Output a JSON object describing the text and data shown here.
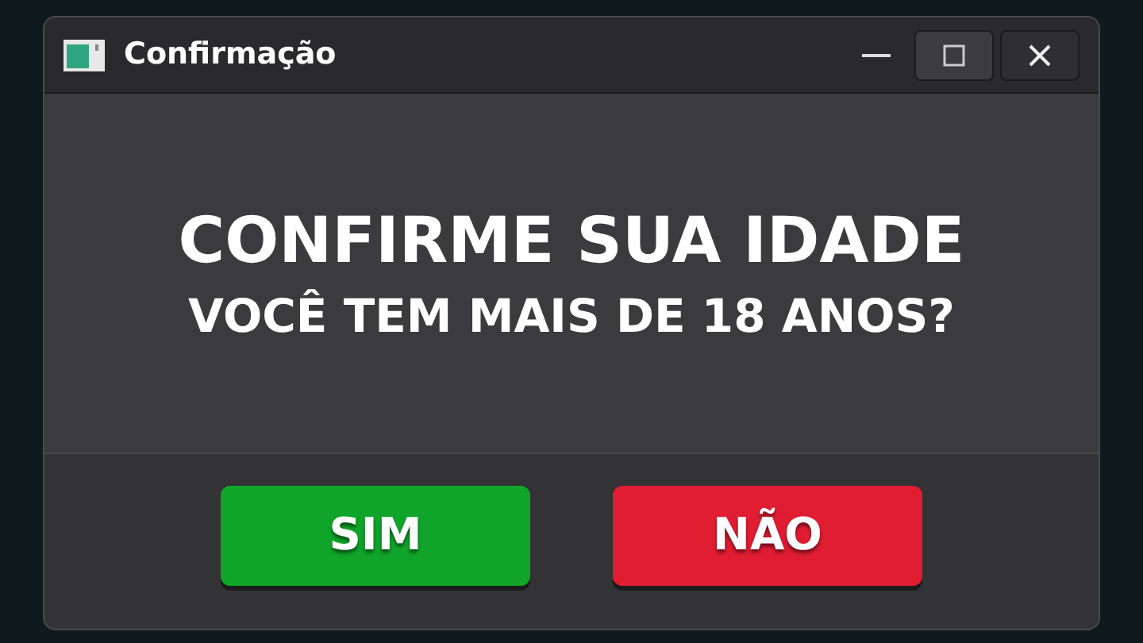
{
  "window": {
    "title": "Confirmação"
  },
  "heading": "CONFIRME SUA IDADE",
  "question": "VOCÊ TEM MAIS DE 18 ANOS?",
  "buttons": [
    {
      "label": "SIM",
      "color": "#10a52a"
    },
    {
      "label": "NÃO",
      "color": "#e11d33"
    }
  ]
}
